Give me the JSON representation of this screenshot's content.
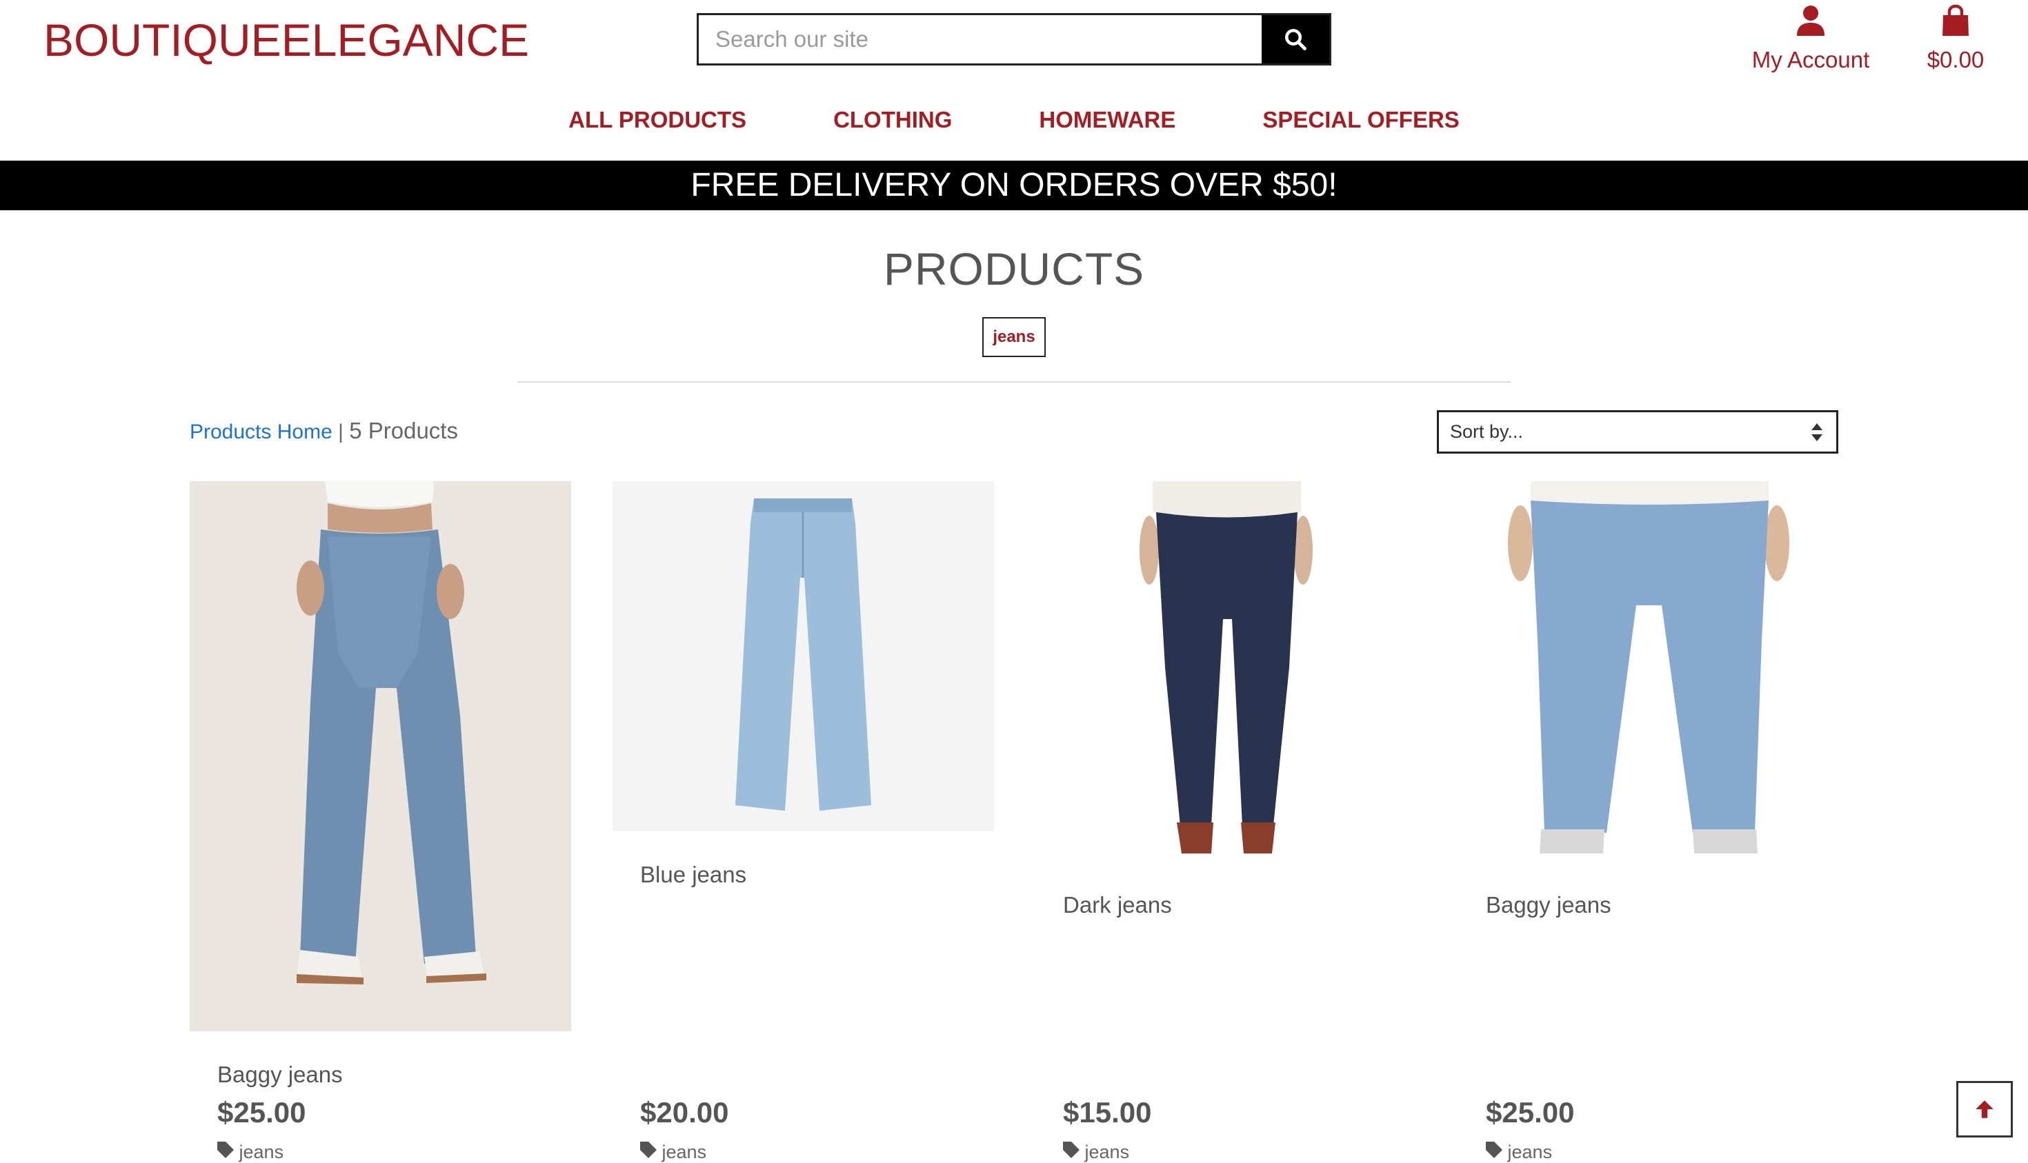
{
  "header": {
    "logo": "BOUTIQUEELEGANCE",
    "search_placeholder": "Search our site",
    "account_label": "My Account",
    "cart_total": "$0.00"
  },
  "nav": {
    "items": [
      "ALL PRODUCTS",
      "CLOTHING",
      "HOMEWARE",
      "SPECIAL OFFERS"
    ]
  },
  "banner": "FREE DELIVERY ON ORDERS OVER $50!",
  "main": {
    "title": "PRODUCTS",
    "active_tag": "jeans",
    "breadcrumb_link": "Products Home",
    "breadcrumb_sep": " | ",
    "product_count": "5 Products",
    "sort_label": "Sort by..."
  },
  "products": [
    {
      "name": "Baggy jeans",
      "price": "$25.00",
      "tag": "jeans"
    },
    {
      "name": "Blue jeans",
      "price": "$20.00",
      "tag": "jeans"
    },
    {
      "name": "Dark jeans",
      "price": "$15.00",
      "tag": "jeans"
    },
    {
      "name": "Baggy jeans",
      "price": "$25.00",
      "tag": "jeans"
    }
  ],
  "colors": {
    "brand": "#a51d23",
    "banner_bg": "#000000",
    "link": "#1a73d9"
  }
}
